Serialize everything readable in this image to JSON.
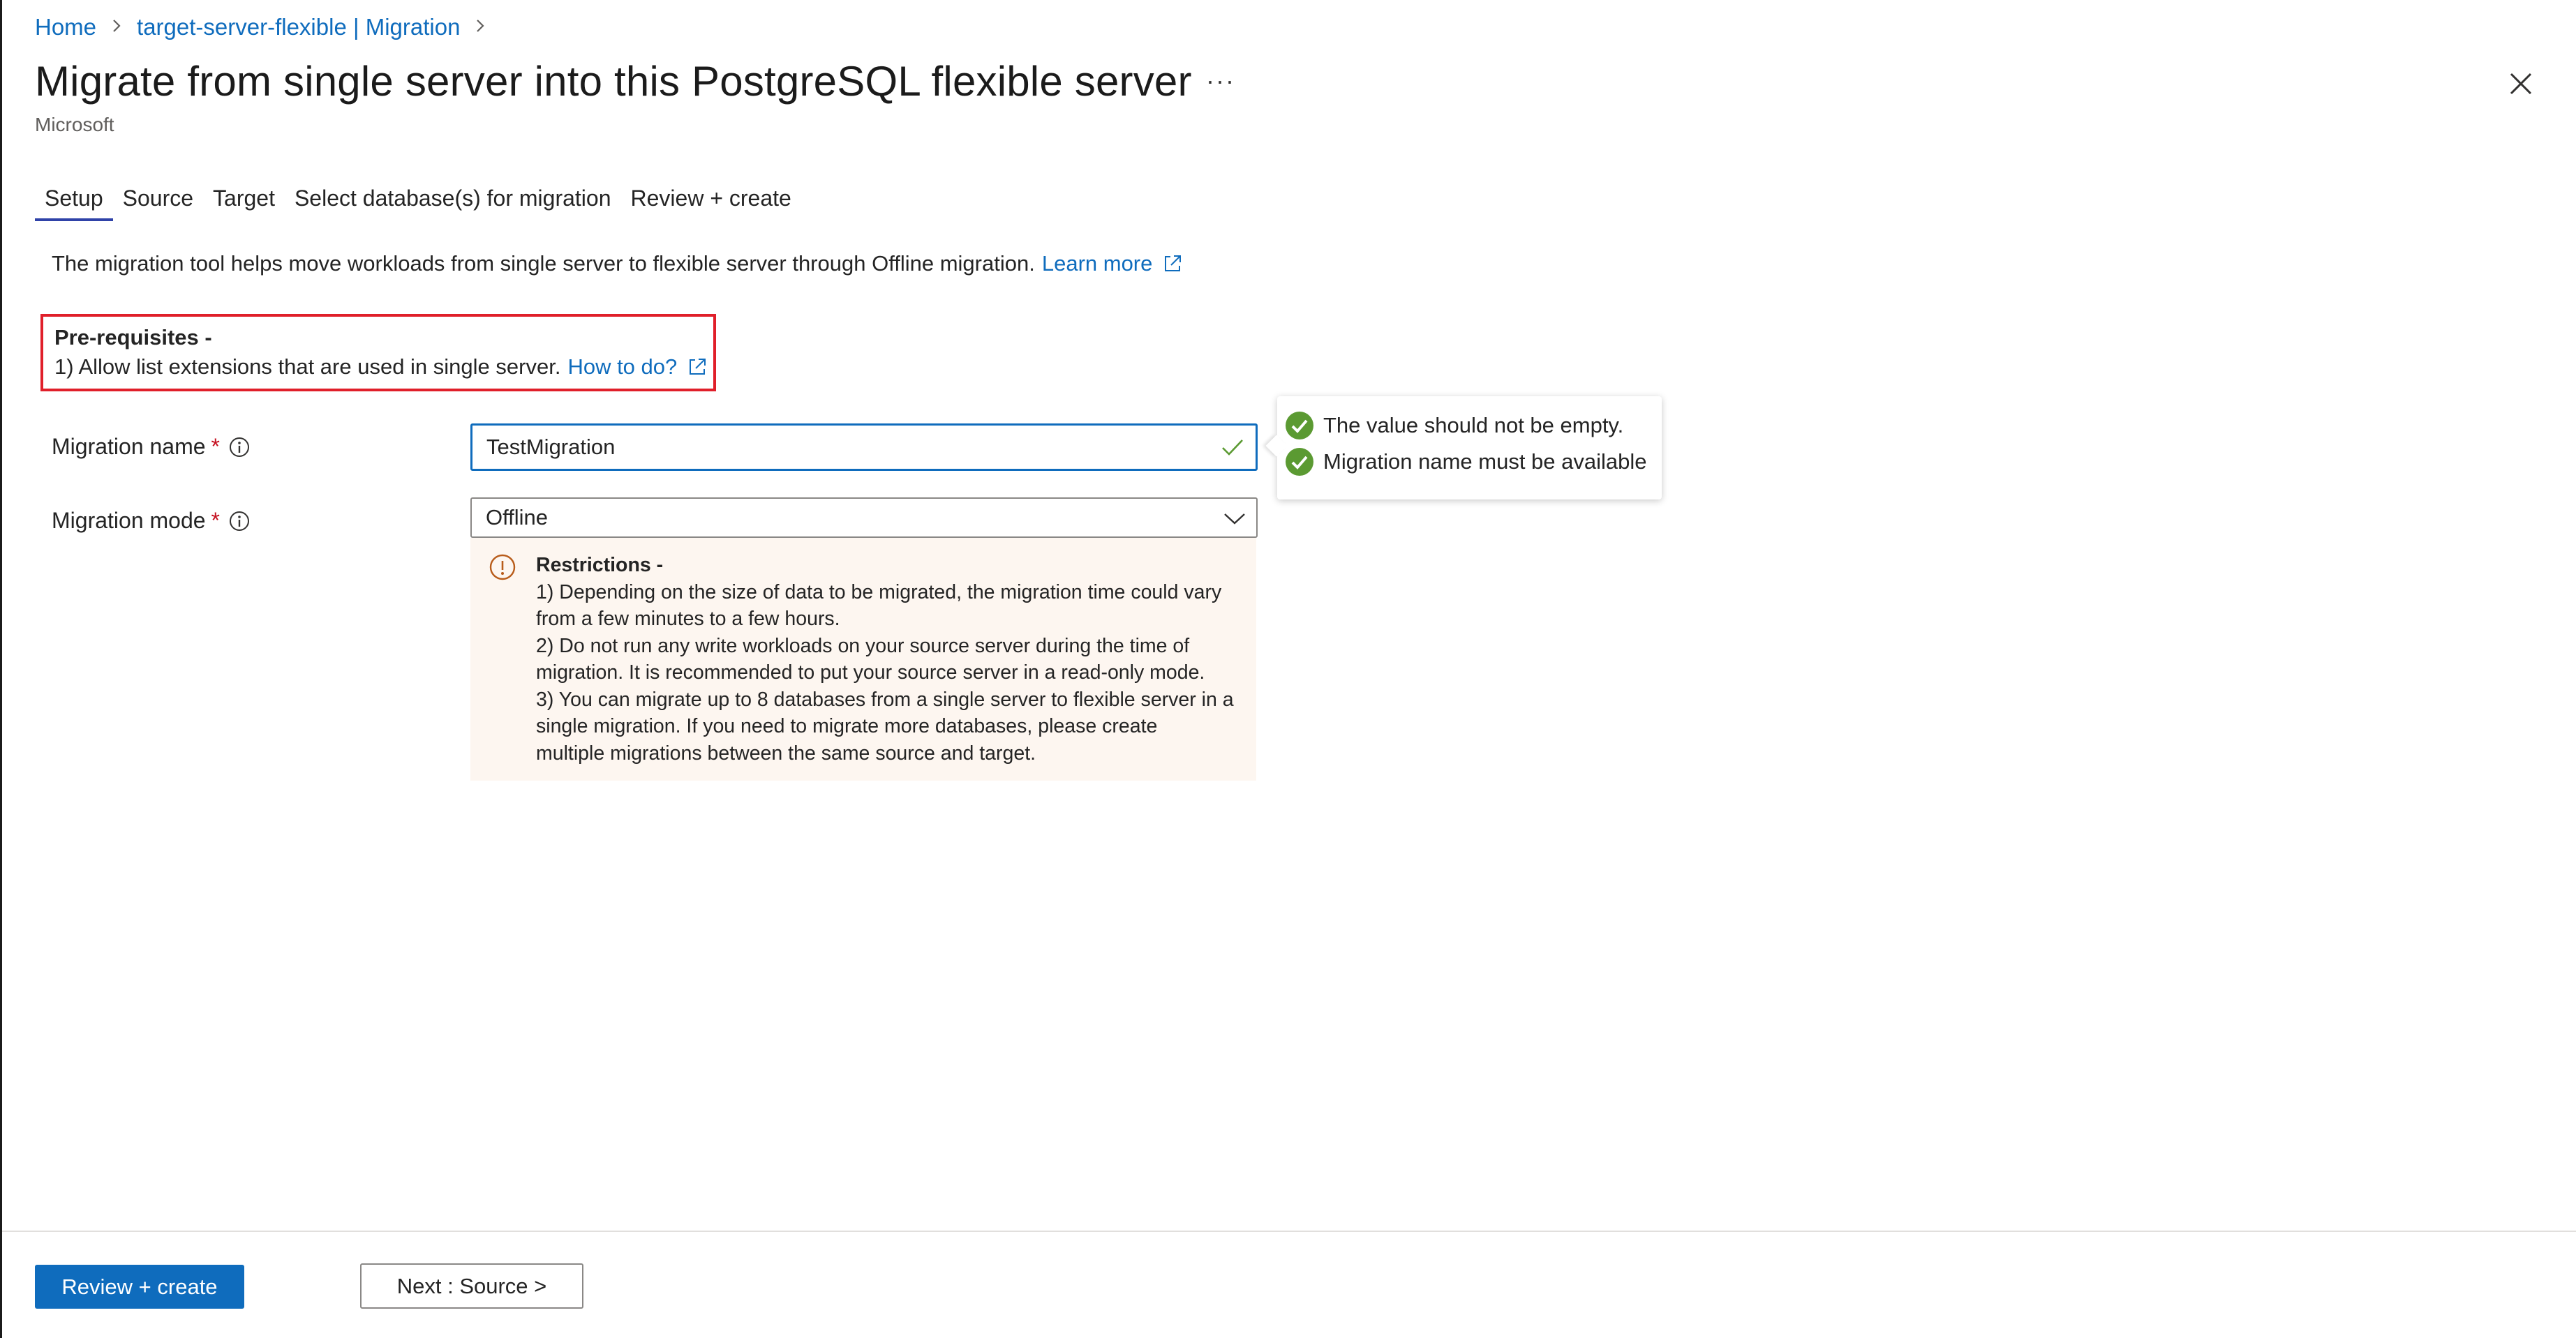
{
  "breadcrumb": {
    "items": [
      "Home",
      "target-server-flexible | Migration"
    ],
    "separator": ">"
  },
  "header": {
    "title": "Migrate from single server into this PostgreSQL flexible server",
    "subtitle": "Microsoft",
    "more_label": "···"
  },
  "tabs": [
    {
      "label": "Setup",
      "active": true
    },
    {
      "label": "Source",
      "active": false
    },
    {
      "label": "Target",
      "active": false
    },
    {
      "label": "Select database(s) for migration",
      "active": false
    },
    {
      "label": "Review + create",
      "active": false
    }
  ],
  "intro": {
    "text": "The migration tool helps move workloads from single server to flexible server through Offline migration.",
    "link": "Learn more"
  },
  "prereq": {
    "title": "Pre-requisites -",
    "line": "1) Allow list extensions that are used in single server.",
    "link": "How to do?"
  },
  "form": {
    "migration_name": {
      "label": "Migration name",
      "required": "*",
      "value": "TestMigration"
    },
    "migration_mode": {
      "label": "Migration mode",
      "required": "*",
      "value": "Offline"
    }
  },
  "validation": {
    "items": [
      "The value should not be empty.",
      "Migration name must be available"
    ]
  },
  "restrictions": {
    "title": "Restrictions -",
    "lines": [
      "1) Depending on the size of data to be migrated, the migration time could vary",
      "from a few minutes to a few hours.",
      "2) Do not run any write workloads on your source server during the time of",
      "migration. It is recommended to put your source server in a read-only mode.",
      "3) You can migrate up to 8 databases from a single server to flexible server in a",
      "single migration. If you need to migrate more databases, please create",
      "multiple migrations between the same source and target."
    ]
  },
  "footer": {
    "primary": "Review + create",
    "secondary": "Next : Source >"
  },
  "colors": {
    "accent": "#0f6cbd",
    "highlight_border": "#e01f2a",
    "success": "#5b9a32",
    "warning": "#b85c1a",
    "restrictions_bg": "#fdf6f0"
  },
  "icons": [
    "chevron-right-icon",
    "more-icon",
    "close-icon",
    "external-link-icon",
    "info-icon",
    "checkmark-icon",
    "success-check-icon",
    "chevron-down-icon",
    "warning-info-icon"
  ]
}
